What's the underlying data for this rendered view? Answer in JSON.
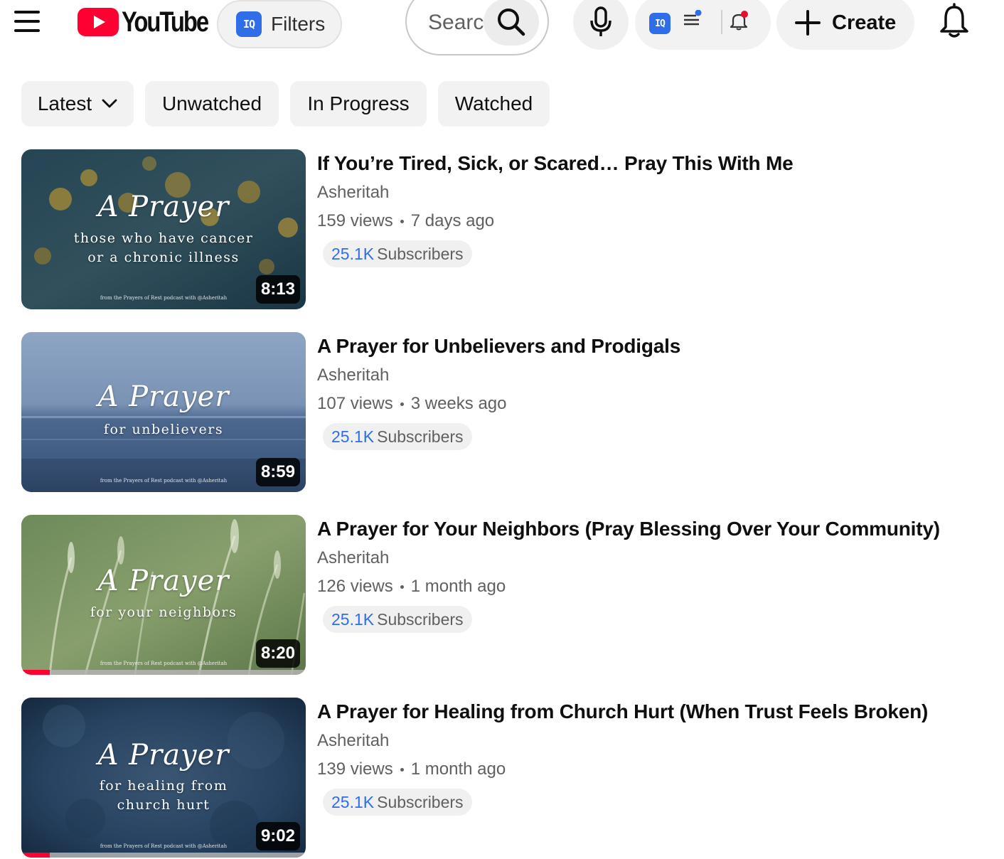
{
  "app": {
    "logo_text": "YouTube"
  },
  "header": {
    "filters_label": "Filters",
    "search_placeholder": "Search",
    "create_label": "Create"
  },
  "chips": [
    {
      "label": "Latest",
      "has_dropdown": true
    },
    {
      "label": "Unwatched"
    },
    {
      "label": "In Progress"
    },
    {
      "label": "Watched"
    }
  ],
  "videos": [
    {
      "title": "If You’re Tired, Sick, or Scared… Pray This With Me",
      "channel": "Asheritah",
      "views": "159 views",
      "age": "7 days ago",
      "subs_count": "25.1K",
      "subs_word": "Subscribers",
      "duration": "8:13",
      "thumb_script": "A Prayer",
      "thumb_sub": "those who have cancer\nor a chronic illness",
      "thumb_credit": "from the Prayers of Rest podcast with @Asheritah",
      "progress": 0
    },
    {
      "title": "A Prayer for Unbelievers and Prodigals",
      "channel": "Asheritah",
      "views": "107 views",
      "age": "3 weeks ago",
      "subs_count": "25.1K",
      "subs_word": "Subscribers",
      "duration": "8:59",
      "thumb_script": "A Prayer",
      "thumb_sub": "for unbelievers",
      "thumb_credit": "from the Prayers of Rest podcast with @Asheritah",
      "progress": 0
    },
    {
      "title": "A Prayer for Your Neighbors (Pray Blessing Over Your Community)",
      "channel": "Asheritah",
      "views": "126 views",
      "age": "1 month ago",
      "subs_count": "25.1K",
      "subs_word": "Subscribers",
      "duration": "8:20",
      "thumb_script": "A Prayer",
      "thumb_sub": "for your neighbors",
      "thumb_credit": "from the Prayers of Rest podcast with @Asheritah",
      "progress": 0.1
    },
    {
      "title": "A Prayer for Healing from Church Hurt (When Trust Feels Broken)",
      "channel": "Asheritah",
      "views": "139 views",
      "age": "1 month ago",
      "subs_count": "25.1K",
      "subs_word": "Subscribers",
      "duration": "9:02",
      "thumb_script": "A Prayer",
      "thumb_sub": "for healing from\nchurch hurt",
      "thumb_credit": "from the Prayers of Rest podcast with @Asheritah",
      "progress": 0.1
    }
  ],
  "colors": {
    "brand_red": "#ff0033",
    "link_blue": "#2f6ee8",
    "chip_bg": "#f2f2f2",
    "secondary_text": "#606060"
  },
  "icons": [
    "menu-icon",
    "youtube-logo-icon",
    "extension-icon",
    "search-icon",
    "mic-icon",
    "list-icon",
    "bell-icon",
    "plus-icon",
    "notifications-icon",
    "chevron-down-icon"
  ]
}
